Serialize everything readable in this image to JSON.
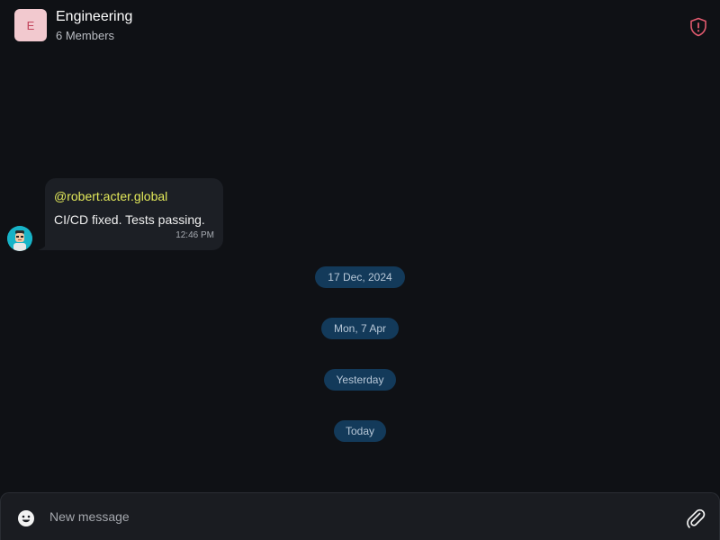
{
  "header": {
    "avatar_letter": "E",
    "title": "Engineering",
    "subtitle": "6 Members",
    "shield_icon": "shield-alert-icon"
  },
  "colors": {
    "background": "#0f1115",
    "bubble": "#1c1f25",
    "sender": "#e3e95a",
    "date_chip": "#133a5a",
    "alert": "#e05a6e"
  },
  "message": {
    "sender": "@robert:acter.global",
    "text": "CI/CD fixed. Tests passing.",
    "time": "12:46 PM"
  },
  "date_separators": [
    "17 Dec, 2024",
    "Mon, 7 Apr",
    "Yesterday",
    "Today"
  ],
  "composer": {
    "placeholder": "New message",
    "emoji_icon": "emoji-icon",
    "attach_icon": "paperclip-icon"
  }
}
